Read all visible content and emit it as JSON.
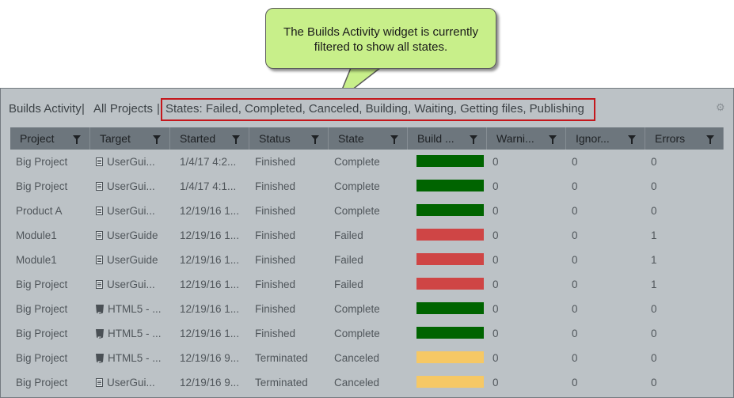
{
  "callout": {
    "line1": "The Builds Activity widget is currently",
    "line2": "filtered to show all states."
  },
  "widget": {
    "title": "Builds Activity",
    "separator": "|",
    "project_filter": "All Projects",
    "states_filter": "States: Failed, Completed, Canceled, Building, Waiting, Getting files, Publishing",
    "settings_icon": "gear-icon"
  },
  "columns": [
    "Project",
    "Target",
    "Started",
    "Status",
    "State",
    "Build ...",
    "Warni...",
    "Ignor...",
    "Errors"
  ],
  "colors": {
    "complete": "#006400",
    "failed": "#cf4545",
    "canceled": "#f6c865"
  },
  "rows": [
    {
      "project": "Big Project",
      "target_icon": "document-icon",
      "target": "UserGui...",
      "started": "1/4/17 4:2...",
      "status": "Finished",
      "state": "Complete",
      "bar": "complete",
      "warnings": "0",
      "ignored": "0",
      "errors": "0"
    },
    {
      "project": "Big Project",
      "target_icon": "document-icon",
      "target": "UserGui...",
      "started": "1/4/17 4:1...",
      "status": "Finished",
      "state": "Complete",
      "bar": "complete",
      "warnings": "0",
      "ignored": "0",
      "errors": "0"
    },
    {
      "project": "Product A",
      "target_icon": "document-icon",
      "target": "UserGui...",
      "started": "12/19/16 1...",
      "status": "Finished",
      "state": "Complete",
      "bar": "complete",
      "warnings": "0",
      "ignored": "0",
      "errors": "0"
    },
    {
      "project": "Module1",
      "target_icon": "document-icon",
      "target": "UserGuide",
      "started": "12/19/16 1...",
      "status": "Finished",
      "state": "Failed",
      "bar": "failed",
      "warnings": "0",
      "ignored": "0",
      "errors": "1"
    },
    {
      "project": "Module1",
      "target_icon": "document-icon",
      "target": "UserGuide",
      "started": "12/19/16 1...",
      "status": "Finished",
      "state": "Failed",
      "bar": "failed",
      "warnings": "0",
      "ignored": "0",
      "errors": "1"
    },
    {
      "project": "Big Project",
      "target_icon": "document-icon",
      "target": "UserGui...",
      "started": "12/19/16 1...",
      "status": "Finished",
      "state": "Failed",
      "bar": "failed",
      "warnings": "0",
      "ignored": "0",
      "errors": "1"
    },
    {
      "project": "Big Project",
      "target_icon": "html5-icon",
      "target": "HTML5 - ...",
      "started": "12/19/16 1...",
      "status": "Finished",
      "state": "Complete",
      "bar": "complete",
      "warnings": "0",
      "ignored": "0",
      "errors": "0"
    },
    {
      "project": "Big Project",
      "target_icon": "html5-icon",
      "target": "HTML5 - ...",
      "started": "12/19/16 1...",
      "status": "Finished",
      "state": "Complete",
      "bar": "complete",
      "warnings": "0",
      "ignored": "0",
      "errors": "0"
    },
    {
      "project": "Big Project",
      "target_icon": "html5-icon",
      "target": "HTML5 - ...",
      "started": "12/19/16 9...",
      "status": "Terminated",
      "state": "Canceled",
      "bar": "canceled",
      "warnings": "0",
      "ignored": "0",
      "errors": "0"
    },
    {
      "project": "Big Project",
      "target_icon": "document-icon",
      "target": "UserGui...",
      "started": "12/19/16 9...",
      "status": "Terminated",
      "state": "Canceled",
      "bar": "canceled",
      "warnings": "0",
      "ignored": "0",
      "errors": "0"
    }
  ]
}
